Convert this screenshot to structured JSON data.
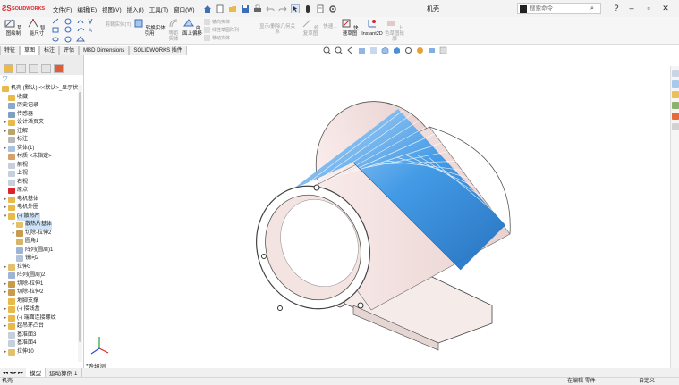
{
  "app": {
    "brand": "SOLIDWORKS",
    "document_title": "机壳"
  },
  "menu": {
    "items": [
      "文件(F)",
      "编辑(E)",
      "视图(V)",
      "插入(I)",
      "工具(T)",
      "窗口(W)"
    ]
  },
  "search": {
    "placeholder": "搜索命令"
  },
  "commands": {
    "sketch": "草图绘制",
    "smart_dim": "智能尺寸",
    "trim": "剪裁实体(T)",
    "convert": "转换实体引用",
    "offset": "等距实体",
    "offset_surface": "曲面上偏移",
    "mirror": "镜向实体",
    "linear_pattern": "线性草图阵列",
    "move": "移动实体",
    "display_relations": "显示/删除几何关系",
    "repair": "修复草图",
    "quick_snap": "快速...",
    "rapid_sketch": "快速草图",
    "instant2d": "Instant2D",
    "shaded_sketch": "上色草图轮廓"
  },
  "cmd_tabs": [
    "特征",
    "草图",
    "标注",
    "评估",
    "MBD Dimensions",
    "SOLIDWORKS 插件"
  ],
  "tree": {
    "root": "机壳 (默认) <<默认>_显示状",
    "items": [
      {
        "label": "收藏",
        "level": 1,
        "exp": "",
        "icon": "folder-icon"
      },
      {
        "label": "历史记录",
        "level": 1,
        "exp": "",
        "icon": "history-icon"
      },
      {
        "label": "传感器",
        "level": 1,
        "exp": "",
        "icon": "sensor-icon"
      },
      {
        "label": "设计活页夹",
        "level": 1,
        "exp": "▸",
        "icon": "binder-icon"
      },
      {
        "label": "注解",
        "level": 1,
        "exp": "▸",
        "icon": "annotation-icon"
      },
      {
        "label": "标注",
        "level": 1,
        "exp": "",
        "icon": "markup-icon"
      },
      {
        "label": "实体(1)",
        "level": 1,
        "exp": "▸",
        "icon": "solid-bodies-icon"
      },
      {
        "label": "材质 <未指定>",
        "level": 1,
        "exp": "",
        "icon": "material-icon"
      },
      {
        "label": "前视",
        "level": 1,
        "exp": "",
        "icon": "plane-icon"
      },
      {
        "label": "上视",
        "level": 1,
        "exp": "",
        "icon": "plane-icon"
      },
      {
        "label": "右视",
        "level": 1,
        "exp": "",
        "icon": "plane-icon"
      },
      {
        "label": "原点",
        "level": 1,
        "exp": "",
        "icon": "origin-icon"
      },
      {
        "label": "电机基体",
        "level": 1,
        "exp": "▸",
        "icon": "folder-icon"
      },
      {
        "label": "电机外圈",
        "level": 1,
        "exp": "▸",
        "icon": "folder-icon"
      },
      {
        "label": "(-) 散热片",
        "level": 1,
        "exp": "▾",
        "icon": "folder-icon",
        "selected": true
      },
      {
        "label": "散热片基体",
        "level": 2,
        "exp": "▸",
        "icon": "extrude-icon",
        "selected": true
      },
      {
        "label": "切除-拉伸2",
        "level": 2,
        "exp": "▸",
        "icon": "cut-icon"
      },
      {
        "label": "圆角1",
        "level": 2,
        "exp": "",
        "icon": "fillet-icon"
      },
      {
        "label": "阵列(圆周)1",
        "level": 2,
        "exp": "",
        "icon": "pattern-icon"
      },
      {
        "label": "镜向2",
        "level": 2,
        "exp": "",
        "icon": "mirror-icon"
      },
      {
        "label": "拉伸3",
        "level": 1,
        "exp": "▸",
        "icon": "extrude-icon"
      },
      {
        "label": "阵列(圆周)2",
        "level": 1,
        "exp": "",
        "icon": "pattern-icon"
      },
      {
        "label": "切除-拉伸1",
        "level": 1,
        "exp": "▸",
        "icon": "cut-icon"
      },
      {
        "label": "切除-拉伸2",
        "level": 1,
        "exp": "▸",
        "icon": "cut-icon"
      },
      {
        "label": "地脚支撑",
        "level": 1,
        "exp": "",
        "icon": "folder-icon"
      },
      {
        "label": "(-) 接线盒",
        "level": 1,
        "exp": "▸",
        "icon": "folder-icon"
      },
      {
        "label": "(-) 端面连接螺纹",
        "level": 1,
        "exp": "▸",
        "icon": "folder-icon"
      },
      {
        "label": "起吊环凸台",
        "level": 1,
        "exp": "▸",
        "icon": "folder-icon"
      },
      {
        "label": "基准面3",
        "level": 1,
        "exp": "",
        "icon": "plane-icon"
      },
      {
        "label": "基准面4",
        "level": 1,
        "exp": "",
        "icon": "plane-icon"
      },
      {
        "label": "拉伸10",
        "level": 1,
        "exp": "▸",
        "icon": "extrude-icon"
      }
    ]
  },
  "bottom_tabs": [
    "模型",
    "运动算例 1"
  ],
  "view_label": "*等轴测",
  "status": {
    "left": "机壳",
    "editing": "在编辑 零件",
    "units": "自定义"
  },
  "colors": {
    "fins": "#3a97e6",
    "body": "#f3e4e2",
    "brand": "#d8262c",
    "selection": "#cde3f7"
  }
}
